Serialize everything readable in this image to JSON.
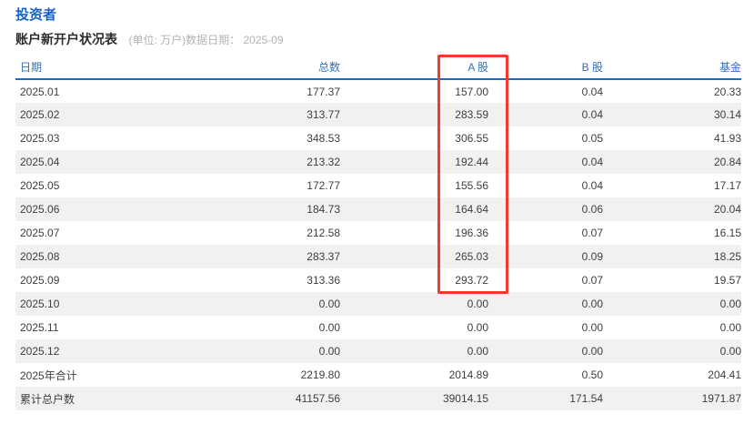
{
  "section": {
    "title": "投资者"
  },
  "caption": {
    "title": "账户新开户状况表",
    "note": "(单位: 万户)数据日期： 2025-09"
  },
  "table": {
    "columns": [
      "日期",
      "总数",
      "A 股",
      "B 股",
      "基金"
    ],
    "rows": [
      [
        "2025.01",
        "177.37",
        "157.00",
        "0.04",
        "20.33"
      ],
      [
        "2025.02",
        "313.77",
        "283.59",
        "0.04",
        "30.14"
      ],
      [
        "2025.03",
        "348.53",
        "306.55",
        "0.05",
        "41.93"
      ],
      [
        "2025.04",
        "213.32",
        "192.44",
        "0.04",
        "20.84"
      ],
      [
        "2025.05",
        "172.77",
        "155.56",
        "0.04",
        "17.17"
      ],
      [
        "2025.06",
        "184.73",
        "164.64",
        "0.06",
        "20.04"
      ],
      [
        "2025.07",
        "212.58",
        "196.36",
        "0.07",
        "16.15"
      ],
      [
        "2025.08",
        "283.37",
        "265.03",
        "0.09",
        "18.25"
      ],
      [
        "2025.09",
        "313.36",
        "293.72",
        "0.07",
        "19.57"
      ],
      [
        "2025.10",
        "0.00",
        "0.00",
        "0.00",
        "0.00"
      ],
      [
        "2025.11",
        "0.00",
        "0.00",
        "0.00",
        "0.00"
      ],
      [
        "2025.12",
        "0.00",
        "0.00",
        "0.00",
        "0.00"
      ],
      [
        "2025年合计",
        "2219.80",
        "2014.89",
        "0.50",
        "204.41"
      ],
      [
        "累计总户数",
        "41157.56",
        "39014.15",
        "171.54",
        "1971.87"
      ]
    ]
  },
  "annotation": {
    "type": "red-highlight-box",
    "target_column": "A 股",
    "rows_covered": "header through 2025.09"
  },
  "colors": {
    "accent_blue": "#1563c2",
    "header_blue": "#2f70bd",
    "underline_blue": "#1a6ac6",
    "highlight_red": "#f03b2c",
    "row_alt_bg": "#f3f1ef"
  }
}
